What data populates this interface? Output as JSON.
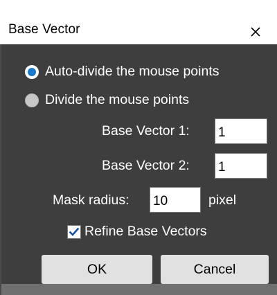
{
  "window": {
    "title": "Base Vector",
    "close_icon": "close-icon"
  },
  "mode": {
    "options": [
      {
        "label": "Auto-divide the mouse points",
        "selected": true
      },
      {
        "label": "Divide the mouse points",
        "selected": false
      }
    ]
  },
  "base_vector_1": {
    "label": "Base Vector 1:",
    "value": "1"
  },
  "base_vector_2": {
    "label": "Base Vector 2:",
    "value": "1"
  },
  "mask_radius": {
    "label": "Mask radius:",
    "value": "10",
    "unit": "pixel"
  },
  "refine": {
    "label": "Refine Base Vectors",
    "checked": true
  },
  "buttons": {
    "ok": "OK",
    "cancel": "Cancel"
  },
  "colors": {
    "panel_bg": "#3e3e3e",
    "radio_accent": "#1c79c8",
    "checkmark": "#1a4f9c"
  }
}
